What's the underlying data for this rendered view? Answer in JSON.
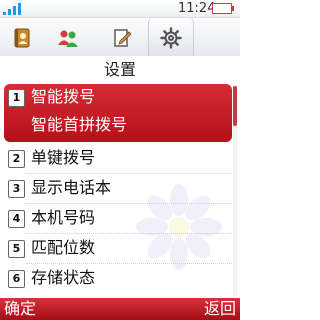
{
  "status": {
    "time": "11:24",
    "signal_bars": 4
  },
  "tabs": [
    {
      "icon": "contacts-book-icon"
    },
    {
      "icon": "people-group-icon"
    },
    {
      "icon": "edit-note-icon"
    },
    {
      "icon": "settings-gear-icon",
      "active": true
    }
  ],
  "title": "设置",
  "list": {
    "selected_index": 1,
    "items": [
      {
        "num": "1",
        "label": "智能拨号",
        "sub": "智能首拼拨号"
      },
      {
        "num": "2",
        "label": "单键拨号"
      },
      {
        "num": "3",
        "label": "显示电话本"
      },
      {
        "num": "4",
        "label": "本机号码"
      },
      {
        "num": "5",
        "label": "匹配位数"
      },
      {
        "num": "6",
        "label": "存储状态"
      }
    ]
  },
  "softkeys": {
    "left": "确定",
    "right": "返回"
  },
  "colors": {
    "accent": "#c41a24",
    "signal": "#1e9be8",
    "battery": "#c24040"
  }
}
